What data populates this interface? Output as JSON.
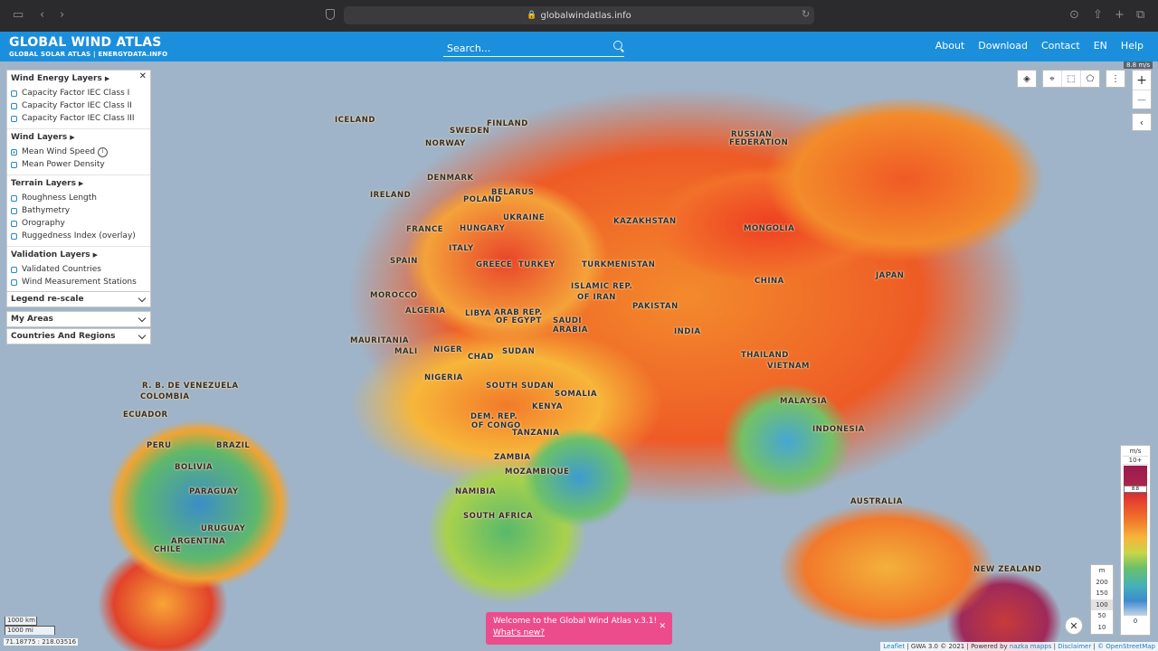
{
  "browser": {
    "url": "globalwindatlas.info"
  },
  "header": {
    "title": "GLOBAL WIND ATLAS",
    "subtitle": "GLOBAL SOLAR ATLAS | ENERGYDATA.INFO",
    "search_placeholder": "Search...",
    "nav": [
      "About",
      "Download",
      "Contact",
      "EN",
      "Help"
    ]
  },
  "panel": {
    "sections": [
      {
        "title": "Wind Energy Layers",
        "options": [
          {
            "label": "Capacity Factor IEC Class I",
            "checked": false
          },
          {
            "label": "Capacity Factor IEC Class II",
            "checked": false
          },
          {
            "label": "Capacity Factor IEC Class III",
            "checked": false
          }
        ]
      },
      {
        "title": "Wind Layers",
        "options": [
          {
            "label": "Mean Wind Speed",
            "checked": true
          },
          {
            "label": "Mean Power Density",
            "checked": false
          }
        ]
      },
      {
        "title": "Terrain Layers",
        "options": [
          {
            "label": "Roughness Length",
            "checked": false
          },
          {
            "label": "Bathymetry",
            "checked": false
          },
          {
            "label": "Orography",
            "checked": false
          },
          {
            "label": "Ruggedness Index (overlay)",
            "checked": false
          }
        ]
      },
      {
        "title": "Validation Layers",
        "options": [
          {
            "label": "Validated Countries",
            "checked": false
          },
          {
            "label": "Wind Measurement Stations",
            "checked": false
          }
        ]
      }
    ],
    "dropdowns": [
      "Legend re-scale",
      "My Areas",
      "Countries And Regions"
    ]
  },
  "map": {
    "labels": [
      "ICELAND",
      "FINLAND",
      "SWEDEN",
      "NORWAY",
      "RUSSIAN",
      "FEDERATION",
      "DENMARK",
      "BELARUS",
      "IRELAND",
      "POLAND",
      "UKRAINE",
      "KAZAKHSTAN",
      "MONGOLIA",
      "FRANCE",
      "HUNGARY",
      "ITALY",
      "SPAIN",
      "GREECE",
      "TURKEY",
      "TURKMENISTAN",
      "ISLAMIC REP.",
      "OF IRAN",
      "CHINA",
      "JAPAN",
      "MOROCCO",
      "ALGERIA",
      "LIBYA",
      "ARAB REP.",
      "OF EGYPT",
      "SAUDI",
      "ARABIA",
      "PAKISTAN",
      "INDIA",
      "MAURITANIA",
      "MALI",
      "NIGER",
      "CHAD",
      "SUDAN",
      "THAILAND",
      "VIETNAM",
      "R. B. DE VENEZUELA",
      "COLOMBIA",
      "NIGERIA",
      "SOUTH SUDAN",
      "SOMALIA",
      "MALAYSIA",
      "ECUADOR",
      "DEM. REP.",
      "OF CONGO",
      "KENYA",
      "INDONESIA",
      "PERU",
      "BRAZIL",
      "TANZANIA",
      "BOLIVIA",
      "ZAMBIA",
      "MOZAMBIQUE",
      "PARAGUAY",
      "NAMIBIA",
      "AUSTRALIA",
      "SOUTH AFRICA",
      "URUGUAY",
      "ARGENTINA",
      "CHILE",
      "NEW ZEALAND"
    ],
    "top_readout": "8.8 m/s",
    "coords": "71.18775 : 218.03516",
    "scale_km": "1000 km",
    "scale_mi": "1000 mi",
    "attribution": {
      "a": "Leaflet",
      "b": "GWA 3.0 © 2021",
      "c": "Powered by",
      "d": "nazka mapps",
      "e": "Disclaimer",
      "f": "© OpenStreetMap"
    }
  },
  "legend_speed": {
    "unit": "m/s",
    "top": "10+",
    "bottom": "0",
    "marker": "8.8"
  },
  "legend_height": {
    "unit": "m",
    "values": [
      "200",
      "150",
      "100",
      "50",
      "10"
    ],
    "selected": "100"
  },
  "toast": {
    "line1": "Welcome to the Global Wind Atlas v.3.1!",
    "line2": "What's new?"
  }
}
